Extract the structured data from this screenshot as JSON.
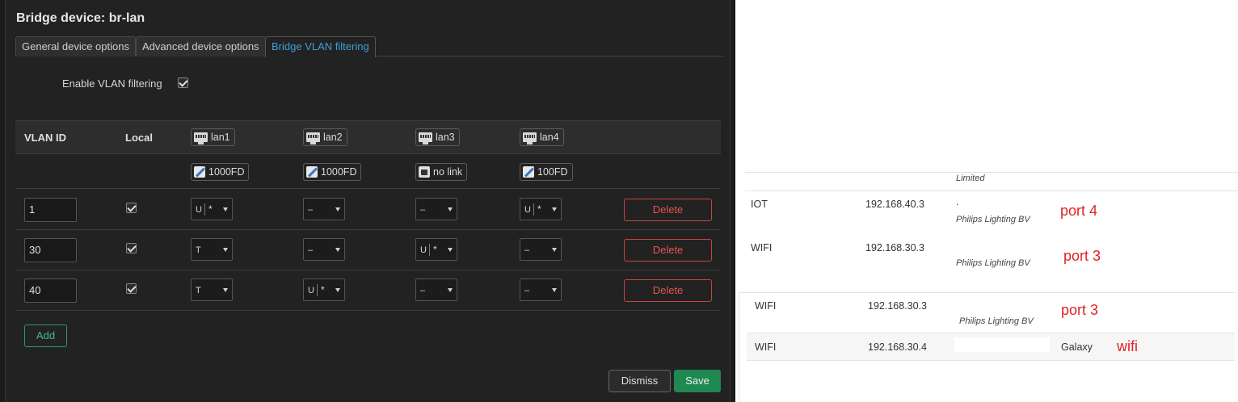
{
  "dialog": {
    "title": "Bridge device: br-lan",
    "tabs": [
      {
        "label": "General device options"
      },
      {
        "label": "Advanced device options"
      },
      {
        "label": "Bridge VLAN filtering"
      }
    ],
    "vlan_filtering_label": "Enable VLAN filtering",
    "headers": {
      "vlan_id": "VLAN ID",
      "local": "Local"
    },
    "ports": [
      {
        "name": "lan1",
        "status": "1000FD"
      },
      {
        "name": "lan2",
        "status": "1000FD"
      },
      {
        "name": "lan3",
        "status": "no link"
      },
      {
        "name": "lan4",
        "status": "100FD"
      }
    ],
    "rows": [
      {
        "vlan_id": "1",
        "ports": [
          {
            "v1": "U",
            "v2": "*"
          },
          {
            "v1": "–",
            "v2": ""
          },
          {
            "v1": "–",
            "v2": ""
          },
          {
            "v1": "U",
            "v2": "*"
          }
        ]
      },
      {
        "vlan_id": "30",
        "ports": [
          {
            "v1": "T",
            "v2": ""
          },
          {
            "v1": "–",
            "v2": ""
          },
          {
            "v1": "U",
            "v2": "*"
          },
          {
            "v1": "–",
            "v2": ""
          }
        ]
      },
      {
        "vlan_id": "40",
        "ports": [
          {
            "v1": "T",
            "v2": ""
          },
          {
            "v1": "U",
            "v2": "*"
          },
          {
            "v1": "–",
            "v2": ""
          },
          {
            "v1": "–",
            "v2": ""
          }
        ]
      }
    ],
    "delete_label": "Delete",
    "add_label": "Add",
    "dismiss_label": "Dismiss",
    "save_label": "Save"
  },
  "clients": {
    "top_note": "Limited",
    "rows": [
      {
        "name": "IOT",
        "ip": "192.168.40.3",
        "vendor_dot": ".",
        "vendor": "Philips Lighting BV",
        "note": "port 4"
      },
      {
        "name": "WIFI",
        "ip": "192.168.30.3",
        "vendor": "Philips Lighting BV",
        "note": "port 3"
      },
      {
        "name": "WIFI",
        "ip": "192.168.30.3",
        "vendor": "Philips Lighting BV",
        "note": "port 3"
      },
      {
        "name": "WIFI",
        "ip": "192.168.30.4",
        "device": "Galaxy",
        "note": "wifi"
      }
    ]
  },
  "colors": {
    "accent_tab": "#3ea0d8",
    "danger": "#e0574d",
    "success": "#1e8a51",
    "annotation": "#e02424"
  }
}
